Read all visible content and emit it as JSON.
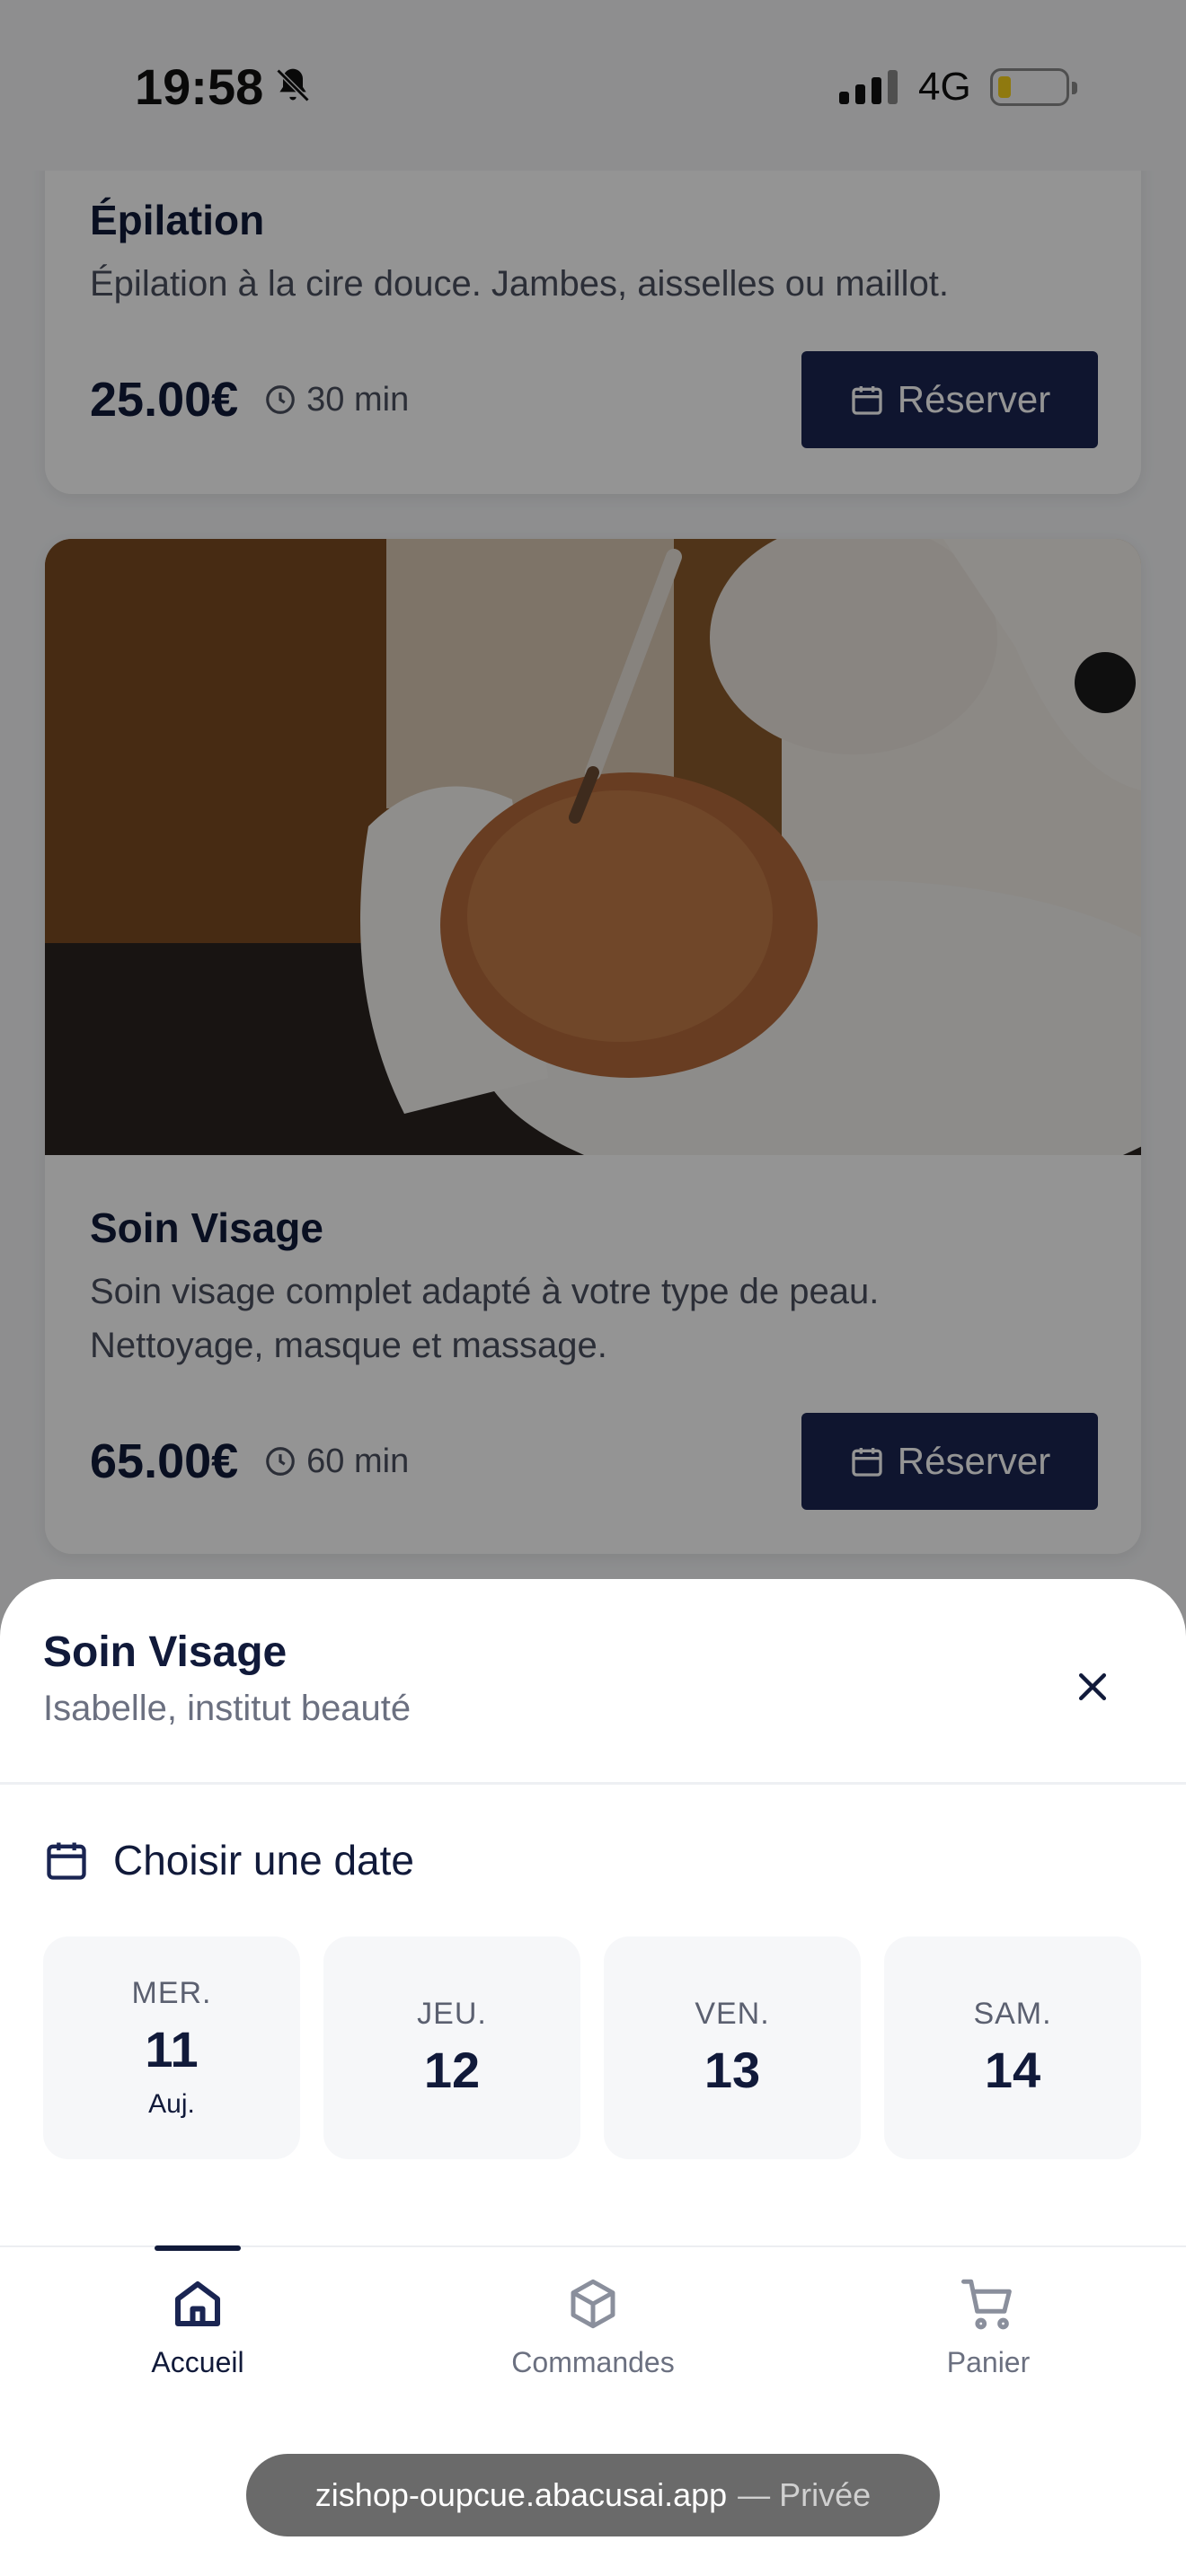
{
  "status_bar": {
    "time": "19:58",
    "network": "4G",
    "icons": [
      "bell-slash-icon",
      "signal-icon",
      "battery-icon"
    ]
  },
  "services": [
    {
      "title": "Épilation",
      "description": "Épilation à la cire douce. Jambes, aisselles ou maillot.",
      "price": "25.00€",
      "duration": "30 min",
      "button_label": "Réserver"
    },
    {
      "title": "Soin Visage",
      "description_line1": "Soin visage complet adapté à votre type de peau.",
      "description_line2": "Nettoyage, masque et massage.",
      "price": "65.00€",
      "duration": "60 min",
      "button_label": "Réserver"
    }
  ],
  "sheet": {
    "title": "Soin Visage",
    "subtitle": "Isabelle, institut beauté",
    "date_heading": "Choisir une date",
    "dates": [
      {
        "dow": "MER.",
        "day": "11",
        "note": "Auj."
      },
      {
        "dow": "JEU.",
        "day": "12"
      },
      {
        "dow": "VEN.",
        "day": "13"
      },
      {
        "dow": "SAM.",
        "day": "14"
      }
    ]
  },
  "tabbar": {
    "tabs": [
      {
        "label": "Accueil",
        "icon": "home-icon",
        "active": true
      },
      {
        "label": "Commandes",
        "icon": "box-icon",
        "active": false
      },
      {
        "label": "Panier",
        "icon": "cart-icon",
        "active": false
      }
    ]
  },
  "browser": {
    "url": "zishop-oupcue.abacusai.app",
    "mode": "— Privée"
  },
  "colors": {
    "primary": "#1a2552",
    "text": "#111a3a",
    "muted": "#6b7080"
  }
}
